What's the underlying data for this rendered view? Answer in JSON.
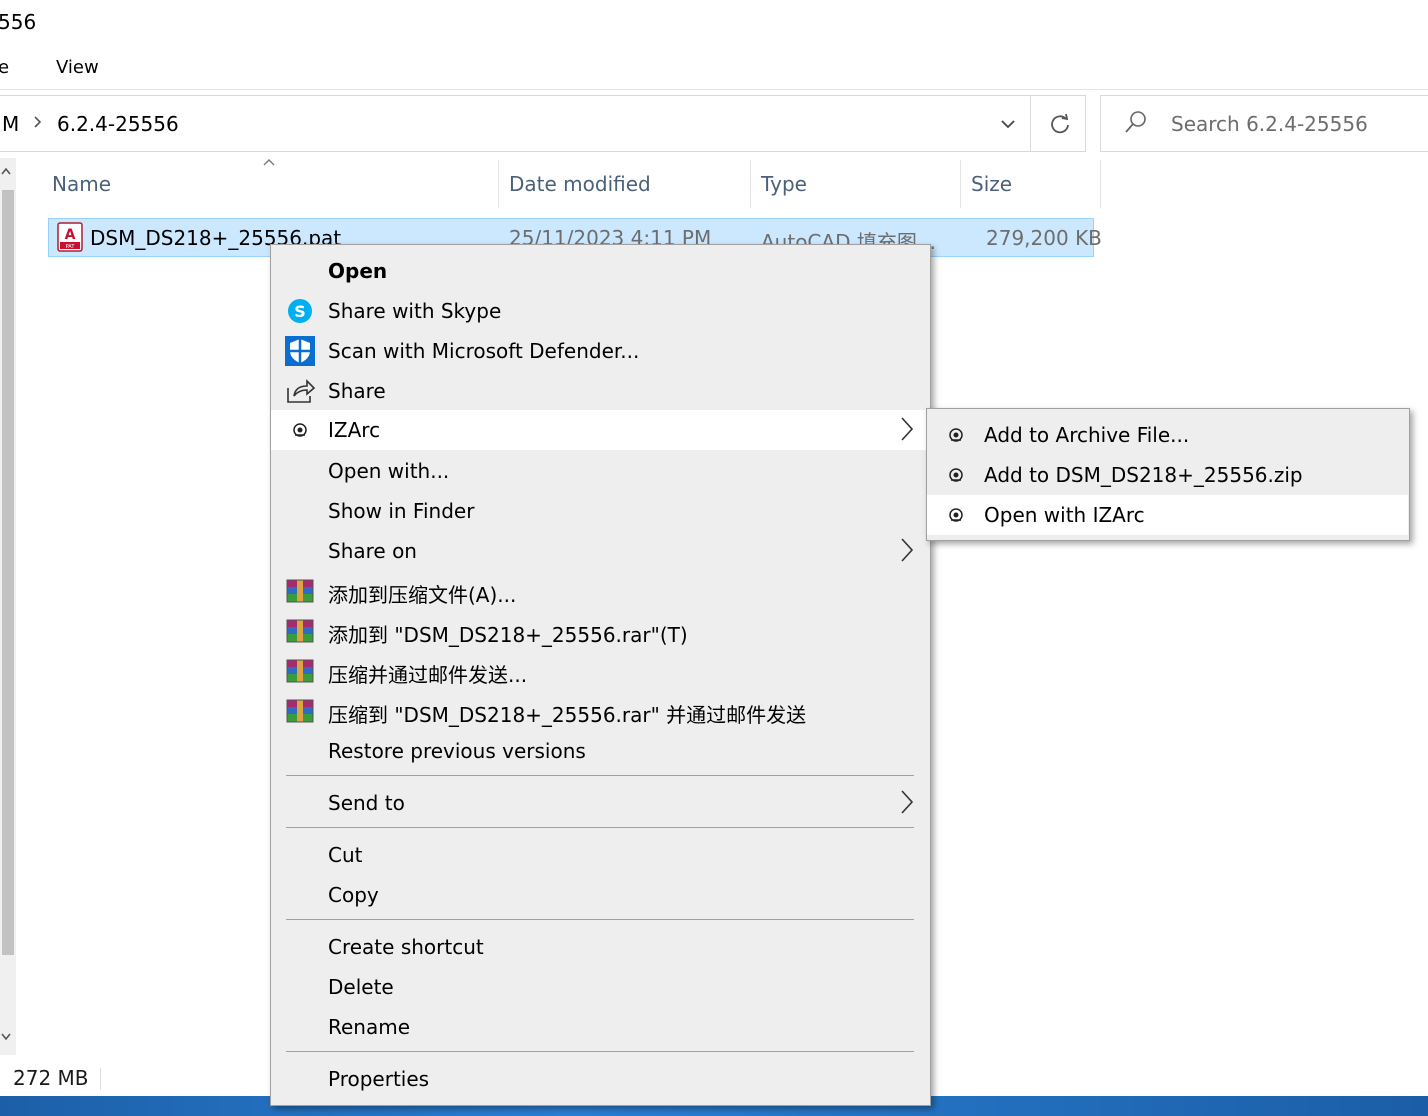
{
  "window": {
    "title_fragment": "556"
  },
  "ribbon": {
    "file_fragment": "e",
    "view": "View"
  },
  "address": {
    "crumb_prev": "M",
    "crumb_current": "6.2.4-25556",
    "search_placeholder": "Search 6.2.4-25556"
  },
  "columns": {
    "name": "Name",
    "date": "Date modified",
    "type": "Type",
    "size": "Size"
  },
  "file": {
    "name": "DSM_DS218+_25556.pat",
    "icon_caption": "PAT",
    "date": "25/11/2023 4:11 PM",
    "type": "AutoCAD 填充图...",
    "size": "279,200 KB"
  },
  "status": {
    "selected_size": "272 MB"
  },
  "context_menu": {
    "open": "Open",
    "share_skype": "Share with Skype",
    "scan_defender": "Scan with Microsoft Defender...",
    "share": "Share",
    "izarc": "IZArc",
    "open_with": "Open with...",
    "show_in_finder": "Show in Finder",
    "share_on": "Share on",
    "rar_add": "添加到压缩文件(A)...",
    "rar_add_named": "添加到 \"DSM_DS218+_25556.rar\"(T)",
    "rar_email": "压缩并通过邮件发送...",
    "rar_named_email": "压缩到 \"DSM_DS218+_25556.rar\" 并通过邮件发送",
    "restore": "Restore previous versions",
    "send_to": "Send to",
    "cut": "Cut",
    "copy": "Copy",
    "create_shortcut": "Create shortcut",
    "delete": "Delete",
    "rename": "Rename",
    "properties": "Properties"
  },
  "izarc_submenu": {
    "add_archive": "Add to Archive File...",
    "add_zip": "Add to DSM_DS218+_25556.zip",
    "open_izarc": "Open with IZArc"
  },
  "colors": {
    "selection": "#cce8ff",
    "menu_bg": "#eeeeee",
    "menu_highlight": "#ffffff",
    "header_text": "#4c607a",
    "skype": "#00aff0",
    "defender": "#0a6ed1"
  }
}
